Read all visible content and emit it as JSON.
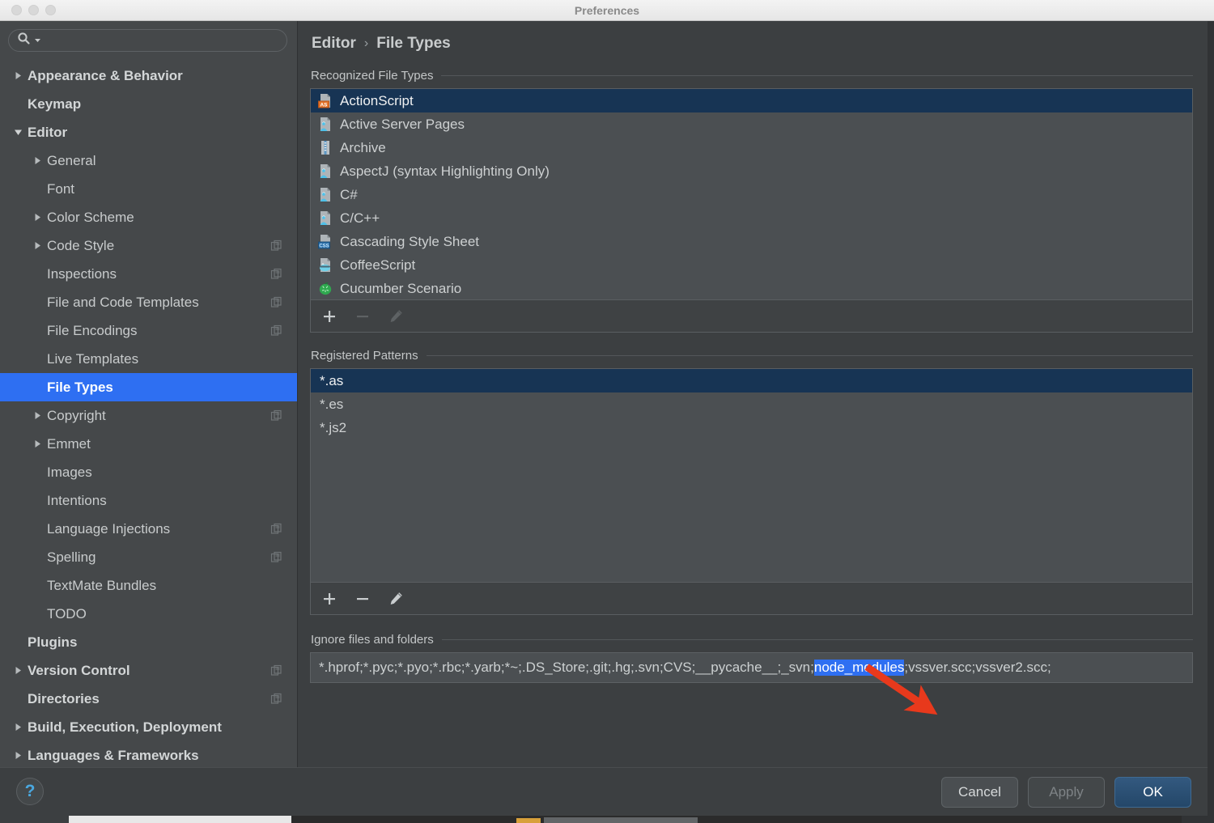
{
  "window": {
    "title": "Preferences",
    "traffic_lights": [
      "close",
      "minimize",
      "zoom"
    ]
  },
  "search": {
    "value": "",
    "placeholder": ""
  },
  "sidebar": {
    "items": [
      {
        "label": "Appearance & Behavior",
        "level": 0,
        "arrow": "collapsed",
        "bold": true,
        "copy": false,
        "selected": false
      },
      {
        "label": "Keymap",
        "level": 0,
        "arrow": "none",
        "bold": true,
        "copy": false,
        "selected": false
      },
      {
        "label": "Editor",
        "level": 0,
        "arrow": "expanded",
        "bold": true,
        "copy": false,
        "selected": false
      },
      {
        "label": "General",
        "level": 1,
        "arrow": "collapsed",
        "bold": false,
        "copy": false,
        "selected": false
      },
      {
        "label": "Font",
        "level": 1,
        "arrow": "none",
        "bold": false,
        "copy": false,
        "selected": false
      },
      {
        "label": "Color Scheme",
        "level": 1,
        "arrow": "collapsed",
        "bold": false,
        "copy": false,
        "selected": false
      },
      {
        "label": "Code Style",
        "level": 1,
        "arrow": "collapsed",
        "bold": false,
        "copy": true,
        "selected": false
      },
      {
        "label": "Inspections",
        "level": 1,
        "arrow": "none",
        "bold": false,
        "copy": true,
        "selected": false
      },
      {
        "label": "File and Code Templates",
        "level": 1,
        "arrow": "none",
        "bold": false,
        "copy": true,
        "selected": false
      },
      {
        "label": "File Encodings",
        "level": 1,
        "arrow": "none",
        "bold": false,
        "copy": true,
        "selected": false
      },
      {
        "label": "Live Templates",
        "level": 1,
        "arrow": "none",
        "bold": false,
        "copy": false,
        "selected": false
      },
      {
        "label": "File Types",
        "level": 1,
        "arrow": "none",
        "bold": false,
        "copy": false,
        "selected": true
      },
      {
        "label": "Copyright",
        "level": 1,
        "arrow": "collapsed",
        "bold": false,
        "copy": true,
        "selected": false
      },
      {
        "label": "Emmet",
        "level": 1,
        "arrow": "collapsed",
        "bold": false,
        "copy": false,
        "selected": false
      },
      {
        "label": "Images",
        "level": 1,
        "arrow": "none",
        "bold": false,
        "copy": false,
        "selected": false
      },
      {
        "label": "Intentions",
        "level": 1,
        "arrow": "none",
        "bold": false,
        "copy": false,
        "selected": false
      },
      {
        "label": "Language Injections",
        "level": 1,
        "arrow": "none",
        "bold": false,
        "copy": true,
        "selected": false
      },
      {
        "label": "Spelling",
        "level": 1,
        "arrow": "none",
        "bold": false,
        "copy": true,
        "selected": false
      },
      {
        "label": "TextMate Bundles",
        "level": 1,
        "arrow": "none",
        "bold": false,
        "copy": false,
        "selected": false
      },
      {
        "label": "TODO",
        "level": 1,
        "arrow": "none",
        "bold": false,
        "copy": false,
        "selected": false
      },
      {
        "label": "Plugins",
        "level": 0,
        "arrow": "none",
        "bold": true,
        "copy": false,
        "selected": false
      },
      {
        "label": "Version Control",
        "level": 0,
        "arrow": "collapsed",
        "bold": true,
        "copy": true,
        "selected": false
      },
      {
        "label": "Directories",
        "level": 0,
        "arrow": "none",
        "bold": true,
        "copy": true,
        "selected": false
      },
      {
        "label": "Build, Execution, Deployment",
        "level": 0,
        "arrow": "collapsed",
        "bold": true,
        "copy": false,
        "selected": false
      },
      {
        "label": "Languages & Frameworks",
        "level": 0,
        "arrow": "collapsed",
        "bold": true,
        "copy": false,
        "selected": false
      }
    ]
  },
  "breadcrumb": {
    "parent": "Editor",
    "separator": "›",
    "current": "File Types"
  },
  "recognized": {
    "title": "Recognized File Types",
    "rows": [
      {
        "label": "ActionScript",
        "icon": "as-file-icon",
        "selected": true
      },
      {
        "label": "Active Server Pages",
        "icon": "generic-lang-icon",
        "selected": false
      },
      {
        "label": "Archive",
        "icon": "archive-icon",
        "selected": false
      },
      {
        "label": "AspectJ (syntax Highlighting Only)",
        "icon": "generic-lang-icon",
        "selected": false
      },
      {
        "label": "C#",
        "icon": "generic-lang-icon",
        "selected": false
      },
      {
        "label": "C/C++",
        "icon": "generic-lang-icon",
        "selected": false
      },
      {
        "label": "Cascading Style Sheet",
        "icon": "css-file-icon",
        "selected": false
      },
      {
        "label": "CoffeeScript",
        "icon": "coffeescript-icon",
        "selected": false
      },
      {
        "label": "Cucumber Scenario",
        "icon": "cucumber-icon",
        "selected": false
      }
    ],
    "toolbar": [
      {
        "name": "add-file-type-button",
        "glyph": "plus-icon",
        "enabled": true
      },
      {
        "name": "remove-file-type-button",
        "glyph": "minus-icon",
        "enabled": false
      },
      {
        "name": "edit-file-type-button",
        "glyph": "pencil-icon",
        "enabled": false
      }
    ]
  },
  "patterns": {
    "title": "Registered Patterns",
    "rows": [
      {
        "label": "*.as",
        "selected": true
      },
      {
        "label": "*.es",
        "selected": false
      },
      {
        "label": "*.js2",
        "selected": false
      }
    ],
    "toolbar": [
      {
        "name": "add-pattern-button",
        "glyph": "plus-icon",
        "enabled": true
      },
      {
        "name": "remove-pattern-button",
        "glyph": "minus-icon",
        "enabled": true
      },
      {
        "name": "edit-pattern-button",
        "glyph": "pencil-icon",
        "enabled": true
      }
    ]
  },
  "ignore": {
    "title": "Ignore files and folders",
    "prefix": "*.hprof;*.pyc;*.pyo;*.rbc;*.yarb;*~;.DS_Store;.git;.hg;.svn;CVS;__pycache__;_svn;",
    "highlighted": "node_modules",
    "suffix": ";vssver.scc;vssver2.scc;",
    "full_value": "*.hprof;*.pyc;*.pyo;*.rbc;*.yarb;*~;.DS_Store;.git;.hg;.svn;CVS;__pycache__;_svn;node_modules;vssver.scc;vssver2.scc;"
  },
  "footer": {
    "help_label": "?",
    "cancel_label": "Cancel",
    "apply_label": "Apply",
    "ok_label": "OK"
  },
  "annotation": {
    "type": "red-arrow",
    "points_to": "node_modules",
    "color": "#e8391c"
  },
  "colors": {
    "accent_blue": "#2e6ff2",
    "selection_navy": "#173454",
    "dialog_bg": "#3c3f41",
    "sidebar_bg": "#45484a",
    "list_bg": "#4b4f52",
    "primary_button": "#2b4f74",
    "annotation_red": "#e8391c"
  }
}
